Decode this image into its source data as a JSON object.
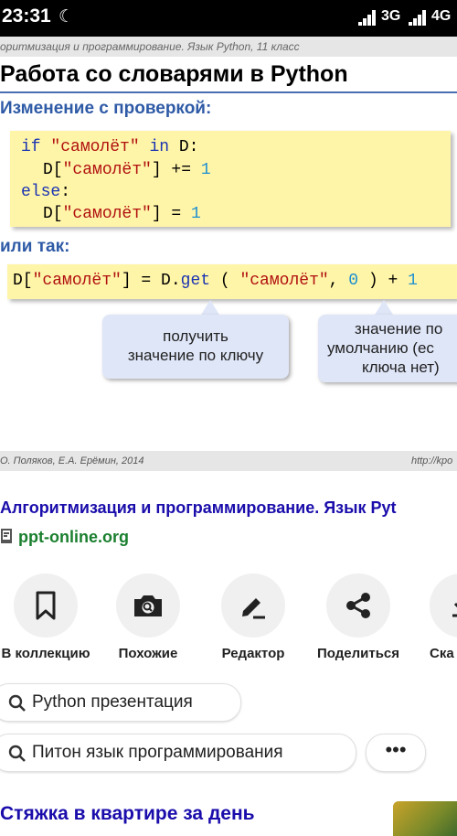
{
  "status_bar": {
    "time": "23:31",
    "net1": "3G",
    "net2": "4G"
  },
  "slide": {
    "header": "оритмизация и программирование. Язык Python, 11 класс",
    "title": "Работа со словарями в Python",
    "subhead1": "Изменение с проверкой:",
    "code1": {
      "l1_kw": "if",
      "l1_str": "\"самолёт\"",
      "l1_in": "in",
      "l1_rest": "D:",
      "l2_a": "D[",
      "l2_str": "\"самолёт\"",
      "l2_op": "] +=",
      "l2_num": "1",
      "l3_kw": "else",
      "l3_colon": ":",
      "l4_a": "D[",
      "l4_str": "\"самолёт\"",
      "l4_op": "] =",
      "l4_num": "1"
    },
    "subhead2": "или так:",
    "code2": {
      "a": "D[",
      "str1": "\"самолёт\"",
      "b": "] = D.",
      "fn": "get",
      "c": " ( ",
      "str2": "\"самолёт\"",
      "d": ", ",
      "num0": "0",
      "e": " ) + ",
      "num1": "1"
    },
    "bubble1": {
      "line1": "получить",
      "line2": "значение по ключу"
    },
    "bubble2": {
      "line1": "значение по",
      "line2": "умолчанию (ес",
      "line3": "ключа нет)"
    },
    "footer_left": "О. Поляков, Е.А. Ерёмин, 2014",
    "footer_right": "http://kpo"
  },
  "result": {
    "title": "Алгоритмизация и программирование. Язык Pyt",
    "site": "ppt-online.org"
  },
  "actions": [
    {
      "label": "В коллекцию",
      "icon": "bookmark-icon"
    },
    {
      "label": "Похожие",
      "icon": "camera-search-icon"
    },
    {
      "label": "Редактор",
      "icon": "edit-icon"
    },
    {
      "label": "Поделиться",
      "icon": "share-icon"
    },
    {
      "label": "Ска",
      "icon": "download-icon"
    }
  ],
  "chips": [
    {
      "text": "Python презентация"
    },
    {
      "text": "Питон язык программирования"
    }
  ],
  "more_label": "•••",
  "next_result": {
    "title": "Стяжка в квартире за день"
  }
}
